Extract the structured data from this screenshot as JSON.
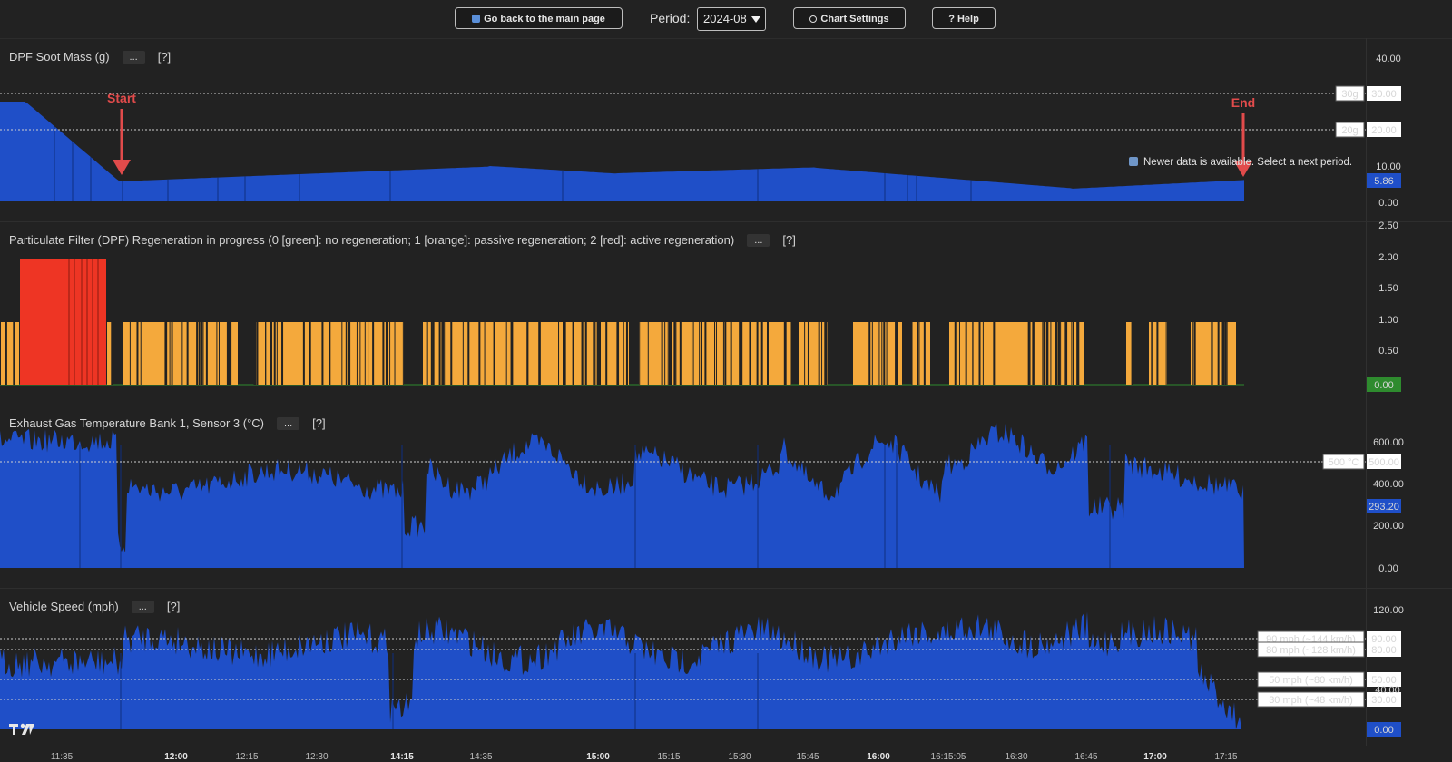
{
  "header": {
    "back_label": "Go back to the main page",
    "period_label": "Period:",
    "period_value": "2024-08",
    "settings_label": "Chart Settings",
    "help_label": "? Help"
  },
  "colors": {
    "background": "#222222",
    "series_blue": "#1f4fc8",
    "regen_orange": "#f4a93c",
    "regen_red": "#ee3524",
    "value_badge_blue": "#1f4fc8",
    "value_badge_green": "#2e8b2e",
    "annotation_red": "#e14b4b"
  },
  "notice": "Newer data is available. Select a next period.",
  "panes": [
    {
      "title": "DPF Soot Mass (g)",
      "more": "...",
      "help": "[?]",
      "y_ticks": [
        "40.00",
        "10.00",
        "0.00"
      ],
      "thresholds": [
        {
          "label": "30g",
          "value": "30.00"
        },
        {
          "label": "20g",
          "value": "20.00"
        }
      ],
      "current": "5.86",
      "annotations": [
        "Start",
        "End"
      ]
    },
    {
      "title": "Particulate Filter (DPF) Regeneration in progress (0 [green]: no regeneration; 1 [orange]: passive regeneration; 2 [red]: active regeneration)",
      "more": "...",
      "help": "[?]",
      "y_ticks": [
        "2.50",
        "2.00",
        "1.50",
        "1.00",
        "0.50"
      ],
      "current": "0.00"
    },
    {
      "title": "Exhaust Gas Temperature Bank 1, Sensor 3 (°C)",
      "more": "...",
      "help": "[?]",
      "y_ticks": [
        "600.00",
        "400.00",
        "200.00",
        "0.00"
      ],
      "thresholds": [
        {
          "label": "500 °C",
          "value": "500.00"
        }
      ],
      "current": "293.20"
    },
    {
      "title": "Vehicle Speed (mph)",
      "more": "...",
      "help": "[?]",
      "y_ticks": [
        "120.00",
        "40.00"
      ],
      "thresholds": [
        {
          "label": "90 mph (~144 km/h)",
          "value": "90.00"
        },
        {
          "label": "80 mph (~128 km/h)",
          "value": "80.00"
        },
        {
          "label": "50 mph (~80 km/h)",
          "value": "50.00"
        },
        {
          "label": "30 mph (~48 km/h)",
          "value": "30.00"
        }
      ],
      "current": "0.00"
    }
  ],
  "time_axis": [
    {
      "label": "11:35",
      "bold": false
    },
    {
      "label": "12:00",
      "bold": true
    },
    {
      "label": "12:15",
      "bold": false
    },
    {
      "label": "12:30",
      "bold": false
    },
    {
      "label": "14:15",
      "bold": true
    },
    {
      "label": "14:35",
      "bold": false
    },
    {
      "label": "15:00",
      "bold": true
    },
    {
      "label": "15:15",
      "bold": false
    },
    {
      "label": "15:30",
      "bold": false
    },
    {
      "label": "15:45",
      "bold": false
    },
    {
      "label": "16:00",
      "bold": true
    },
    {
      "label": "16:15:05",
      "bold": false
    },
    {
      "label": "16:30",
      "bold": false
    },
    {
      "label": "16:45",
      "bold": false
    },
    {
      "label": "17:00",
      "bold": true
    },
    {
      "label": "17:15",
      "bold": false
    }
  ]
}
